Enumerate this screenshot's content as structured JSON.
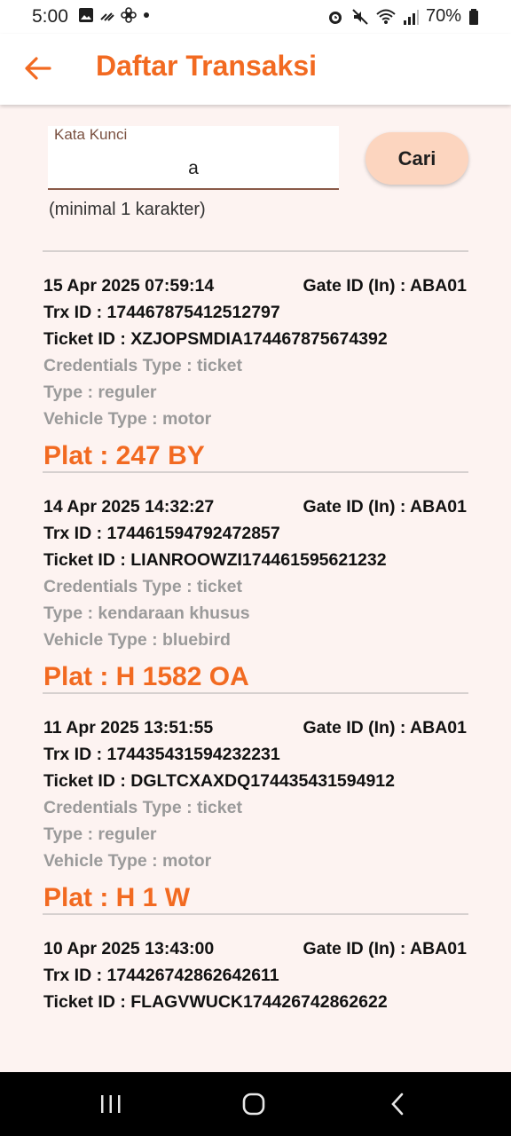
{
  "status": {
    "time": "5:00",
    "battery": "70%"
  },
  "appbar": {
    "title": "Daftar Transaksi"
  },
  "search": {
    "label": "Kata Kunci",
    "value": "a",
    "button": "Cari",
    "helper": "(minimal 1 karakter)"
  },
  "transactions": [
    {
      "date_time": "15 Apr 2025   07:59:14",
      "gate": "Gate ID (In) : ABA01",
      "trx": "Trx ID : 174467875412512797",
      "ticket": "Ticket ID : XZJOPSMDIA174467875674392",
      "credentials": "Credentials Type : ticket",
      "type": "Type : reguler",
      "vehicle": "Vehicle Type : motor",
      "plat": "Plat : 247 BY"
    },
    {
      "date_time": "14 Apr 2025   14:32:27",
      "gate": "Gate ID (In) : ABA01",
      "trx": "Trx ID : 174461594792472857",
      "ticket": "Ticket ID : LIANROOWZI174461595621232",
      "credentials": "Credentials Type : ticket",
      "type": "Type : kendaraan khusus",
      "vehicle": "Vehicle Type : bluebird",
      "plat": "Plat : H 1582 OA"
    },
    {
      "date_time": "11 Apr 2025   13:51:55",
      "gate": "Gate ID (In) : ABA01",
      "trx": "Trx ID : 174435431594232231",
      "ticket": "Ticket ID : DGLTCXAXDQ174435431594912",
      "credentials": "Credentials Type : ticket",
      "type": "Type : reguler",
      "vehicle": "Vehicle Type : motor",
      "plat": "Plat : H 1 W"
    },
    {
      "date_time": "10 Apr 2025   13:43:00",
      "gate": "Gate ID (In) : ABA01",
      "trx": "Trx ID : 174426742862642611",
      "ticket": "Ticket ID : FLAGVWUCK174426742862622",
      "credentials": "",
      "type": "",
      "vehicle": "",
      "plat": ""
    }
  ],
  "colors": {
    "accent": "#f26a21",
    "background": "#fdf3f1",
    "button": "#fcd5bf"
  },
  "icons": {
    "back": "arrow-left-icon",
    "nav_recents": "recents-icon",
    "nav_home": "home-icon",
    "nav_back": "nav-back-icon"
  }
}
